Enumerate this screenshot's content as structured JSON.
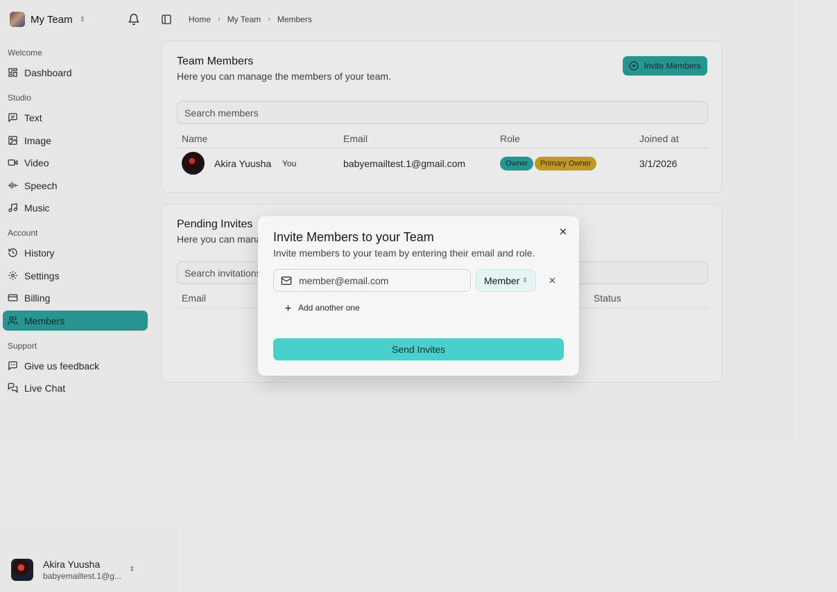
{
  "sidebar": {
    "team_name": "My Team",
    "sections": {
      "welcome": "Welcome",
      "studio": "Studio",
      "account": "Account",
      "support": "Support"
    },
    "items": {
      "dashboard": "Dashboard",
      "text": "Text",
      "image": "Image",
      "video": "Video",
      "speech": "Speech",
      "music": "Music",
      "history": "History",
      "settings": "Settings",
      "billing": "Billing",
      "members": "Members",
      "feedback": "Give us feedback",
      "live_chat": "Live Chat"
    },
    "active_item": "Members",
    "user": {
      "name": "Akira Yuusha",
      "email": "babyemailtest.1@g..."
    }
  },
  "breadcrumb": [
    "Home",
    "My Team",
    "Members"
  ],
  "members_card": {
    "title": "Team Members",
    "description": "Here you can manage the members of your team.",
    "invite_button": "Invite Members",
    "search_placeholder": "Search members",
    "columns": [
      "Name",
      "Email",
      "Role",
      "Joined at"
    ],
    "rows": [
      {
        "name": "Akira Yuusha",
        "you_label": "You",
        "email": "babyemailtest.1@gmail.com",
        "roles": [
          "Owner",
          "Primary Owner"
        ],
        "joined_at": "3/1/2026"
      }
    ]
  },
  "pending_card": {
    "title": "Pending Invites",
    "description": "Here you can manag",
    "search_placeholder": "Search invitations",
    "columns": [
      "Email",
      "Status"
    ]
  },
  "modal": {
    "title": "Invite Members to your Team",
    "description": "Invite members to your team by entering their email and role.",
    "email_placeholder": "member@email.com",
    "role_value": "Member",
    "add_another": "Add another one",
    "send_button": "Send Invites"
  },
  "colors": {
    "accent": "#2a9c97",
    "send_button": "#4ad0cc",
    "owner_badge": "#2a9c97",
    "primary_owner_badge": "#c9a227"
  }
}
